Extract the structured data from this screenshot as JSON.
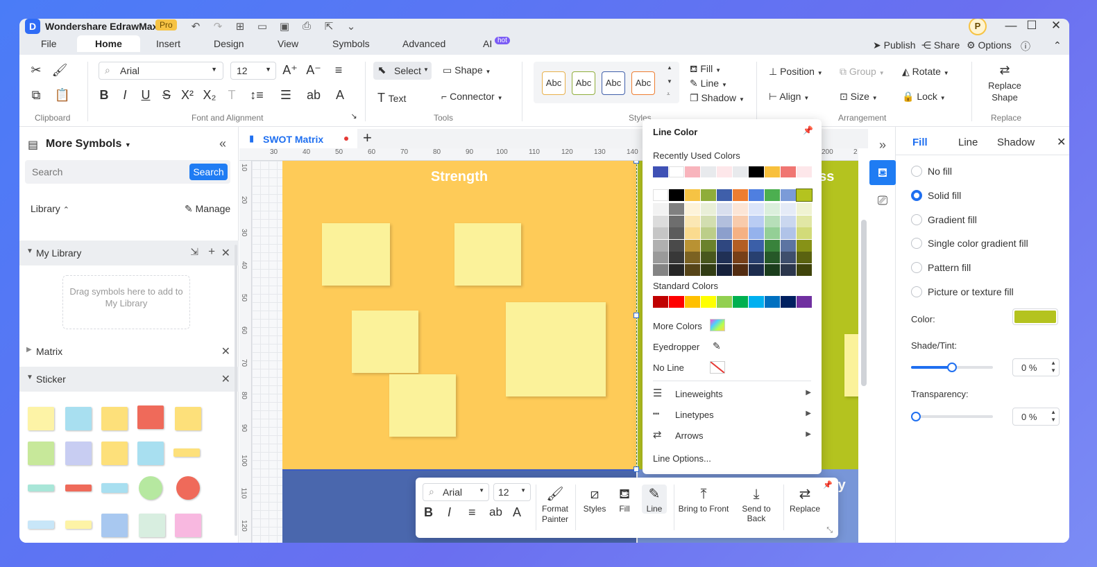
{
  "app": {
    "name": "Wondershare EdrawMax",
    "badge": "Pro",
    "user_initial": "P"
  },
  "menu": {
    "tabs": [
      "File",
      "Home",
      "Insert",
      "Design",
      "View",
      "Symbols",
      "Advanced",
      "AI"
    ],
    "active": "Home",
    "ai_badge": "hot",
    "right": {
      "publish": "Publish",
      "share": "Share",
      "options": "Options"
    }
  },
  "ribbon": {
    "font": "Arial",
    "size": "12",
    "select": "Select",
    "shape": "Shape",
    "text": "Text",
    "connector": "Connector",
    "style_previews": [
      "Abc",
      "Abc",
      "Abc",
      "Abc"
    ],
    "fill": "Fill",
    "line": "Line",
    "shadow": "Shadow",
    "position": "Position",
    "group": "Group",
    "rotate": "Rotate",
    "align": "Align",
    "size_btn": "Size",
    "lock": "Lock",
    "replace_shape": "Replace Shape",
    "groups": [
      "Clipboard",
      "Font and Alignment",
      "Tools",
      "Styles",
      "Arrangement",
      "Replace"
    ]
  },
  "left_panel": {
    "title": "More Symbols",
    "search_placeholder": "Search",
    "search_btn": "Search",
    "library": "Library",
    "manage": "Manage",
    "my_library": "My Library",
    "drag_hint": "Drag symbols here to add to My Library",
    "matrix": "Matrix",
    "sticker": "Sticker"
  },
  "document": {
    "tab": "SWOT Matrix"
  },
  "ruler": {
    "top": [
      "30",
      "40",
      "50",
      "60",
      "70",
      "80",
      "90",
      "100",
      "110",
      "120",
      "130",
      "140",
      "200",
      "2"
    ],
    "left": [
      "10",
      "20",
      "30",
      "40",
      "50",
      "60",
      "70",
      "80",
      "90",
      "100",
      "110",
      "120"
    ]
  },
  "canvas": {
    "strength_title": "Strength",
    "right_title_fragment": "ess",
    "bottom_right_fragment": "ty"
  },
  "line_color_popup": {
    "title": "Line Color",
    "recent_label": "Recently Used Colors",
    "recent_colors": [
      "#3f51b5",
      "#ffffff",
      "#f8b4bc",
      "#e8eaed",
      "#fde7ea",
      "#e8eaed",
      "#000000",
      "#f8c03c",
      "#f07672",
      "#fde7ea"
    ],
    "theme_top": [
      "#ffffff",
      "#000000",
      "#f6c344",
      "#8fad3a",
      "#3f5faa",
      "#ee7d30",
      "#4f7fe0",
      "#4caf50",
      "#7b9bd8",
      "#b4c31f"
    ],
    "standard_label": "Standard Colors",
    "standard_colors": [
      "#c00000",
      "#ff0000",
      "#ffc000",
      "#ffff00",
      "#92d050",
      "#00b050",
      "#00b0f0",
      "#0070c0",
      "#002060",
      "#7030a0"
    ],
    "more_colors": "More Colors",
    "eyedropper": "Eyedropper",
    "no_line": "No Line",
    "lineweights": "Lineweights",
    "linetypes": "Linetypes",
    "arrows": "Arrows",
    "line_options": "Line Options..."
  },
  "right_panel": {
    "tabs": [
      "Fill",
      "Line",
      "Shadow"
    ],
    "active_tab": "Fill",
    "options": [
      "No fill",
      "Solid fill",
      "Gradient fill",
      "Single color gradient fill",
      "Pattern fill",
      "Picture or texture fill"
    ],
    "selected_option": "Solid fill",
    "color_label": "Color:",
    "fill_color": "#b4c31f",
    "shade_label": "Shade/Tint:",
    "shade_value": "0 %",
    "shade_level": 0.5,
    "transparency_label": "Transparency:",
    "transparency_value": "0 %"
  },
  "float_toolbar": {
    "font": "Arial",
    "size": "12",
    "format_painter": "Format Painter",
    "styles": "Styles",
    "fill": "Fill",
    "line": "Line",
    "bring_front": "Bring to Front",
    "send_back": "Send to Back",
    "replace": "Replace"
  }
}
